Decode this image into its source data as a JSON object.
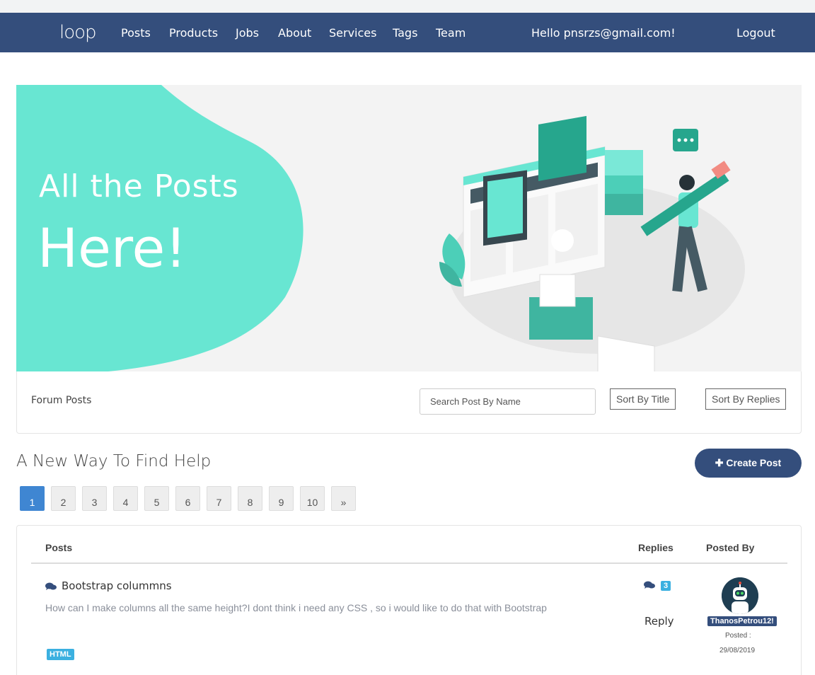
{
  "nav": {
    "logo": "loop",
    "links": [
      "Posts",
      "Products",
      "Jobs",
      "About",
      "Services",
      "Tags",
      "Team"
    ],
    "greeting": "Hello pnsrzs@gmail.com!",
    "logout": "Logout"
  },
  "hero": {
    "line1": "All the Posts",
    "line2": "Here!"
  },
  "forum_bar": {
    "label": "Forum Posts",
    "search_placeholder": "Search Post By Name",
    "sort_title": "Sort By Title",
    "sort_replies": "Sort By Replies"
  },
  "main": {
    "heading": "A New Way To Find Help",
    "create_button": "Create Post"
  },
  "pagination": {
    "pages": [
      "1",
      "2",
      "3",
      "4",
      "5",
      "6",
      "7",
      "8",
      "9",
      "10"
    ],
    "next": "»",
    "active": "1"
  },
  "table": {
    "headers": {
      "posts": "Posts",
      "replies": "Replies",
      "posted_by": "Posted By"
    },
    "rows": [
      {
        "title": "Bootstrap colummns",
        "description": "How can I make columns all the same height?I dont think i need any CSS , so i would like to do that with Bootstrap",
        "tag": "HTML",
        "reply_count": "3",
        "reply_label": "Reply",
        "username": "ThanosPetrou12!",
        "posted_label": "Posted :",
        "posted_date": "29/08/2019"
      }
    ]
  },
  "colors": {
    "navbar": "#344e7c",
    "hero_accent": "#68e6d2",
    "badge": "#3bb0e0",
    "active_page": "#3f86d2"
  }
}
